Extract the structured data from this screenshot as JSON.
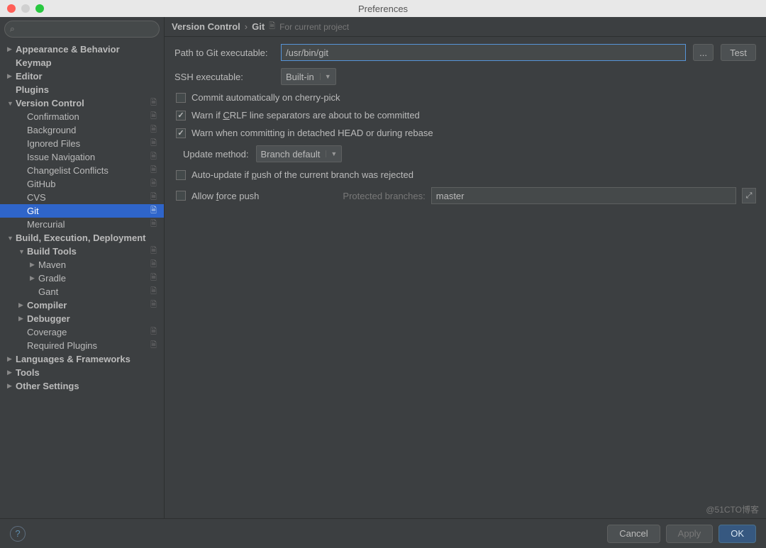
{
  "window": {
    "title": "Preferences"
  },
  "search": {
    "placeholder": ""
  },
  "breadcrumb": {
    "parent": "Version Control",
    "current": "Git",
    "hint": "For current project"
  },
  "sidebar": {
    "items": [
      {
        "label": "Appearance & Behavior",
        "level": 0,
        "arrow": "▶",
        "bold": true
      },
      {
        "label": "Keymap",
        "level": 0,
        "arrow": "",
        "bold": true
      },
      {
        "label": "Editor",
        "level": 0,
        "arrow": "▶",
        "bold": true
      },
      {
        "label": "Plugins",
        "level": 0,
        "arrow": "",
        "bold": true
      },
      {
        "label": "Version Control",
        "level": 0,
        "arrow": "▼",
        "bold": true,
        "proj": true
      },
      {
        "label": "Confirmation",
        "level": 1,
        "arrow": "",
        "proj": true
      },
      {
        "label": "Background",
        "level": 1,
        "arrow": "",
        "proj": true
      },
      {
        "label": "Ignored Files",
        "level": 1,
        "arrow": "",
        "proj": true
      },
      {
        "label": "Issue Navigation",
        "level": 1,
        "arrow": "",
        "proj": true
      },
      {
        "label": "Changelist Conflicts",
        "level": 1,
        "arrow": "",
        "proj": true
      },
      {
        "label": "GitHub",
        "level": 1,
        "arrow": "",
        "proj": true
      },
      {
        "label": "CVS",
        "level": 1,
        "arrow": "",
        "proj": true
      },
      {
        "label": "Git",
        "level": 1,
        "arrow": "",
        "proj": true,
        "selected": true
      },
      {
        "label": "Mercurial",
        "level": 1,
        "arrow": "",
        "proj": true
      },
      {
        "label": "Build, Execution, Deployment",
        "level": 0,
        "arrow": "▼",
        "bold": true
      },
      {
        "label": "Build Tools",
        "level": 1,
        "arrow": "▼",
        "bold": true,
        "proj": true
      },
      {
        "label": "Maven",
        "level": 2,
        "arrow": "▶",
        "proj": true
      },
      {
        "label": "Gradle",
        "level": 2,
        "arrow": "▶",
        "proj": true
      },
      {
        "label": "Gant",
        "level": 2,
        "arrow": "",
        "proj": true
      },
      {
        "label": "Compiler",
        "level": 1,
        "arrow": "▶",
        "bold": true,
        "proj": true
      },
      {
        "label": "Debugger",
        "level": 1,
        "arrow": "▶",
        "bold": true
      },
      {
        "label": "Coverage",
        "level": 1,
        "arrow": "",
        "proj": true
      },
      {
        "label": "Required Plugins",
        "level": 1,
        "arrow": "",
        "proj": true
      },
      {
        "label": "Languages & Frameworks",
        "level": 0,
        "arrow": "▶",
        "bold": true
      },
      {
        "label": "Tools",
        "level": 0,
        "arrow": "▶",
        "bold": true
      },
      {
        "label": "Other Settings",
        "level": 0,
        "arrow": "▶",
        "bold": true
      }
    ]
  },
  "form": {
    "path_label": "Path to Git executable:",
    "path_value": "/usr/bin/git",
    "browse_label": "...",
    "test_label": "Test",
    "ssh_label": "SSH executable:",
    "ssh_value": "Built-in",
    "cb_cherry": "Commit automatically on cherry-pick",
    "cb_crlf_pre": "Warn if ",
    "cb_crlf_ul": "C",
    "cb_crlf_post": "RLF line separators are about to be committed",
    "cb_detached": "Warn when committing in detached HEAD or during rebase",
    "update_label": "Update method:",
    "update_value": "Branch default",
    "cb_autoupdate_pre": "Auto-update if ",
    "cb_autoupdate_ul": "p",
    "cb_autoupdate_post": "ush of the current branch was rejected",
    "cb_force_pre": "Allow ",
    "cb_force_ul": "f",
    "cb_force_post": "orce push",
    "protected_label": "Protected branches:",
    "protected_value": "master"
  },
  "footer": {
    "cancel": "Cancel",
    "apply": "Apply",
    "ok": "OK"
  },
  "watermark": "@51CTO博客"
}
